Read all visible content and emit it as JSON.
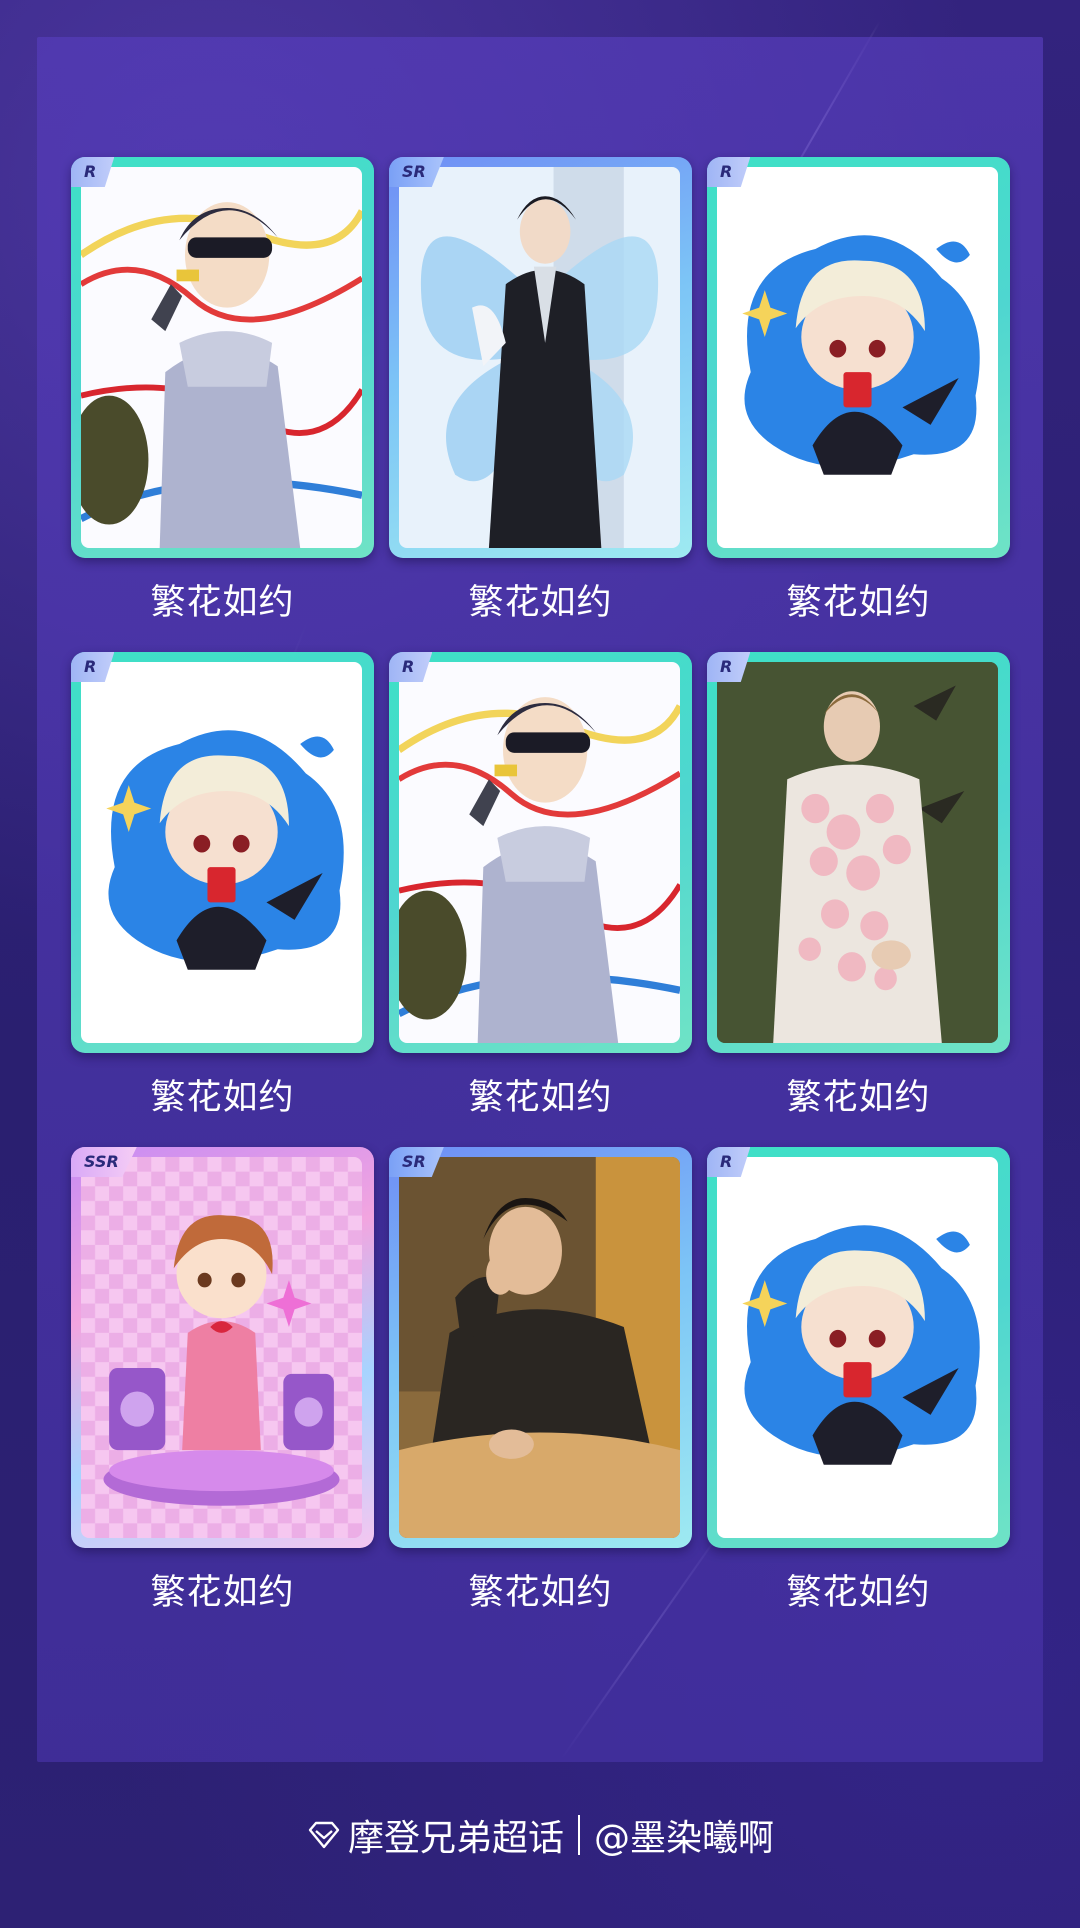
{
  "cards": [
    {
      "rarity": "R",
      "title": "繁花如约",
      "art": "singer-visor-icon"
    },
    {
      "rarity": "SR",
      "title": "繁花如约",
      "art": "butterfly-suit-icon"
    },
    {
      "rarity": "R",
      "title": "繁花如约",
      "art": "chibi-blond-icon"
    },
    {
      "rarity": "R",
      "title": "繁花如约",
      "art": "chibi-blond-icon"
    },
    {
      "rarity": "R",
      "title": "繁花如约",
      "art": "singer-visor-icon"
    },
    {
      "rarity": "R",
      "title": "繁花如约",
      "art": "floral-shirt-icon"
    },
    {
      "rarity": "SSR",
      "title": "繁花如约",
      "art": "chibi-pink-stage-icon"
    },
    {
      "rarity": "SR",
      "title": "繁花如约",
      "art": "black-sweater-icon"
    },
    {
      "rarity": "R",
      "title": "繁花如约",
      "art": "chibi-blond-icon"
    }
  ],
  "footer": {
    "topic": "摩登兄弟超话",
    "author": "@墨染曦啊"
  },
  "colors": {
    "background": "#2e2277",
    "panel": "#5a3db9",
    "frame_r": "#3ee0c6",
    "frame_sr": "#7cc4f6",
    "frame_ssr": "#f2a5e0",
    "caption": "#ffffff"
  }
}
